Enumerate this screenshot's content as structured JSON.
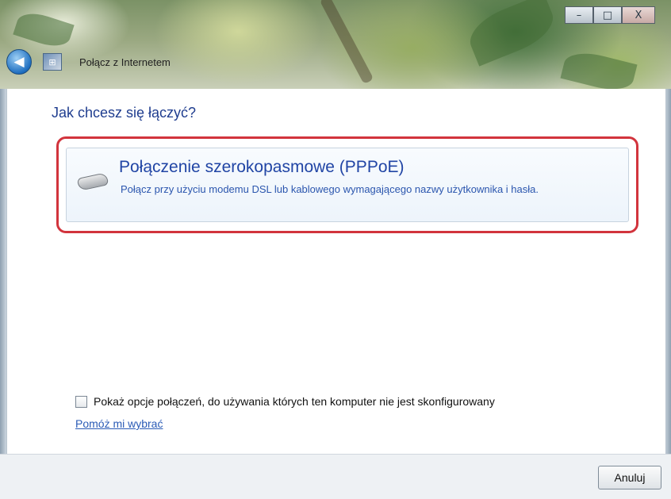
{
  "window": {
    "title": "Połącz z Internetem",
    "controls": {
      "minimize": "–",
      "maximize": "□",
      "close": "X"
    }
  },
  "nav": {
    "back_icon": "back-arrow-icon",
    "app_icon": "network-connect-icon"
  },
  "content": {
    "heading": "Jak chcesz się łączyć?",
    "option": {
      "icon": "modem-icon",
      "title": "Połączenie szerokopasmowe (PPPoE)",
      "description": "Połącz przy użyciu modemu DSL lub kablowego wymagającego nazwy użytkownika i hasła."
    },
    "checkbox_label": "Pokaż opcje połączeń, do używania których ten komputer nie jest skonfigurowany",
    "help_link": "Pomóż mi wybrać"
  },
  "footer": {
    "cancel_label": "Anuluj"
  },
  "colors": {
    "heading": "#1f3d8f",
    "highlight_outline": "#d2343d",
    "link": "#2a5bb6"
  }
}
